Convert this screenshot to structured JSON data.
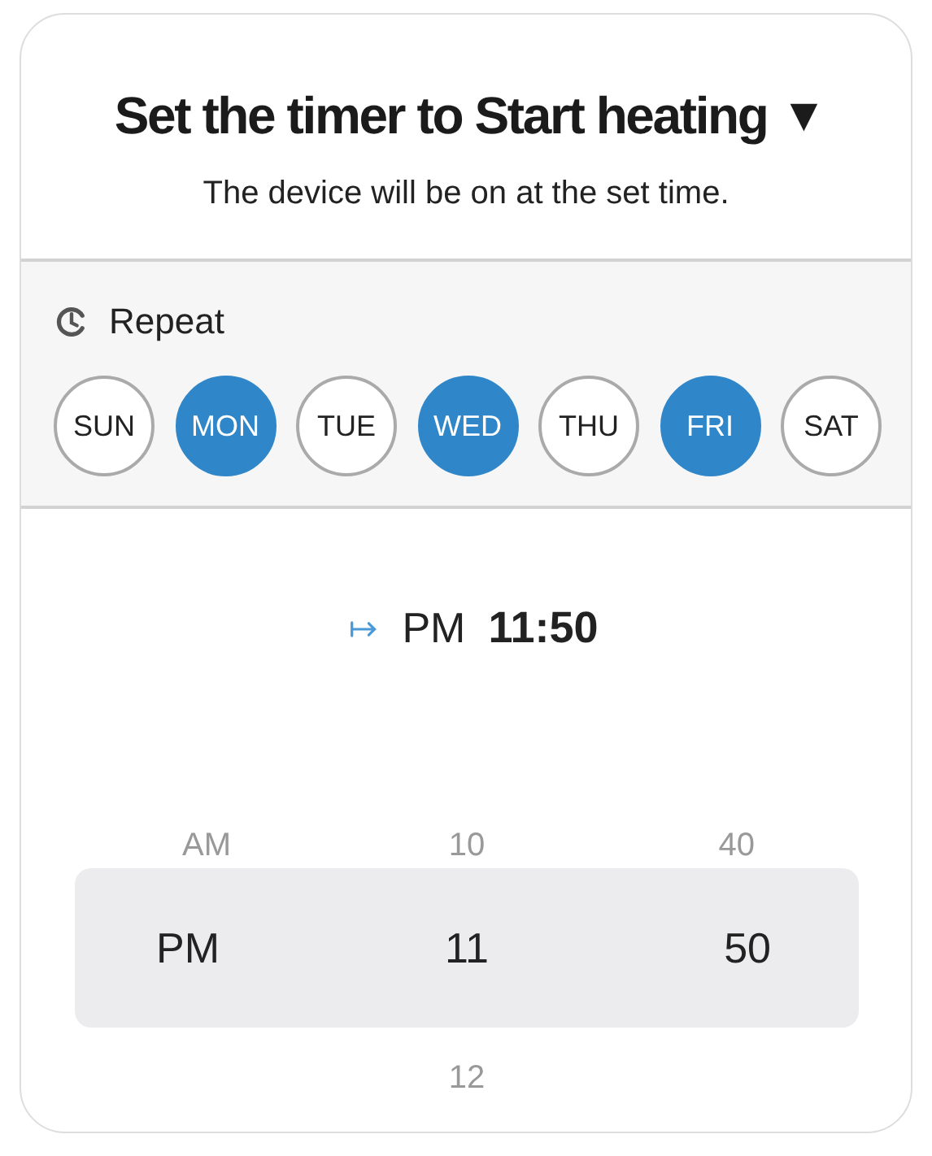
{
  "header": {
    "title": "Set the timer to Start heating",
    "dropdown_glyph": "▼",
    "subtitle": "The device will be on at the set time."
  },
  "repeat": {
    "label": "Repeat",
    "days": [
      {
        "label": "SUN",
        "selected": false
      },
      {
        "label": "MON",
        "selected": true
      },
      {
        "label": "TUE",
        "selected": false
      },
      {
        "label": "WED",
        "selected": true
      },
      {
        "label": "THU",
        "selected": false
      },
      {
        "label": "FRI",
        "selected": true
      },
      {
        "label": "SAT",
        "selected": false
      }
    ]
  },
  "time_display": {
    "period": "PM",
    "time": "11:50"
  },
  "picker": {
    "columns": [
      {
        "items": [
          {
            "label": "AM",
            "selected": false
          },
          {
            "label": "PM",
            "selected": true
          }
        ]
      },
      {
        "items": [
          {
            "label": "10",
            "selected": false
          },
          {
            "label": "11",
            "selected": true
          },
          {
            "label": "12",
            "selected": false
          }
        ]
      },
      {
        "items": [
          {
            "label": "40",
            "selected": false
          },
          {
            "label": "50",
            "selected": true
          }
        ]
      }
    ]
  }
}
